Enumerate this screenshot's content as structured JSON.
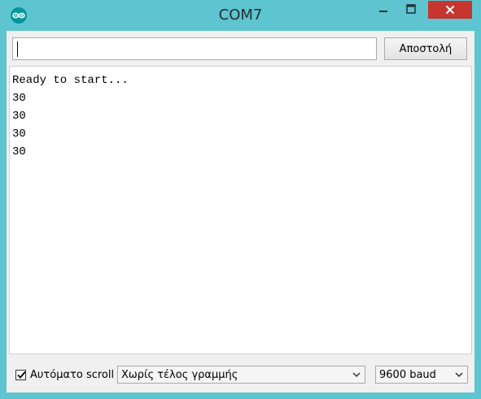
{
  "window": {
    "title": "COM7",
    "icon": "arduino-icon",
    "controls": [
      "minimize-icon",
      "maximize-icon",
      "close-icon"
    ],
    "colors": {
      "frame": "#5ec4cf",
      "close": "#c7352f"
    }
  },
  "send": {
    "input_value": "",
    "button_label": "Αποστολή"
  },
  "output": {
    "lines": [
      "Ready to start...",
      "30",
      "30",
      "30",
      "30"
    ]
  },
  "footer": {
    "autoscroll_label": "Αυτόματο scroll",
    "autoscroll_checked": true,
    "line_ending": "Χωρίς τέλος γραμμής",
    "baud_rate": "9600 baud"
  }
}
